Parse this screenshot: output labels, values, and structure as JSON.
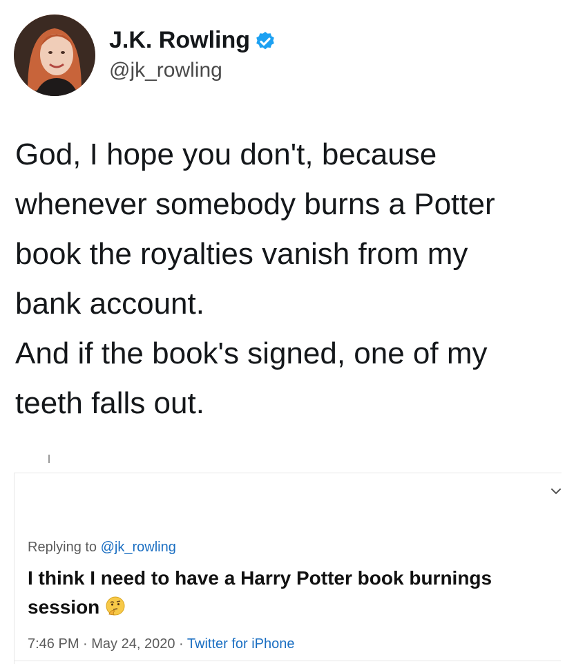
{
  "author": {
    "display_name": "J.K. Rowling",
    "handle": "@jk_rowling",
    "verified": true,
    "avatar_icon": "profile-photo"
  },
  "tweet": {
    "text": "God, I hope you don't, because\nwhenever somebody burns a Potter\nbook the royalties vanish from my\nbank account.\nAnd if the book's signed, one of my\nteeth falls out."
  },
  "reply": {
    "replying_prefix": "Replying to ",
    "replying_mention": "@jk_rowling",
    "text": "I think I need to have a Harry Potter book burnings\nsession",
    "emoji_icon": "thinking-face-emoji",
    "time": "7:46 PM",
    "date": "May 24, 2020",
    "source": "Twitter for iPhone",
    "separator": " · "
  },
  "colors": {
    "text": "#14171a",
    "muted": "#5b5b5b",
    "link": "#1b6fc2",
    "verified_badge": "#1da1f2"
  }
}
